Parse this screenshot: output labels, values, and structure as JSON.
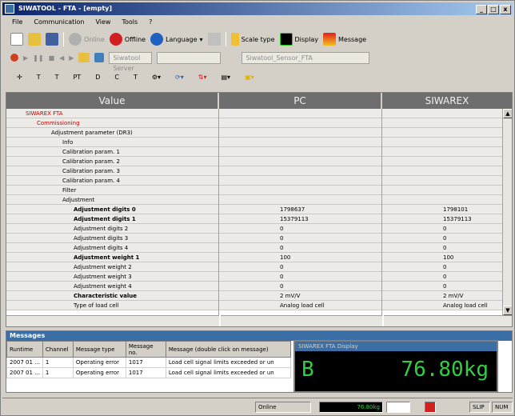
{
  "window": {
    "title": "SIWATOOL - FTA - [empty]"
  },
  "titlebar": {
    "buttons": [
      "_",
      "□",
      "x"
    ]
  },
  "menu": [
    "File",
    "Communication",
    "View",
    "Tools",
    "?"
  ],
  "toolbar1": [
    {
      "label": "Online",
      "disabled": true
    },
    {
      "label": "Offline",
      "disabled": false
    },
    {
      "label": "Language",
      "disabled": false
    },
    {
      "label": "Scale type",
      "disabled": false
    },
    {
      "label": "Display",
      "disabled": false
    },
    {
      "label": "Message",
      "disabled": false
    }
  ],
  "toolbar2": {
    "port": "Siwatool Server",
    "connection": "Siwatool_Sensor_FTA"
  },
  "toolbar3": [
    "T",
    "T",
    "PT",
    "D",
    "C",
    "T"
  ],
  "grid": {
    "headers": {
      "value": "Value",
      "pc": "PC",
      "siwarex": "SIWAREX"
    },
    "rows": [
      {
        "label": "SIWAREX FTA",
        "pc": "",
        "siwarex": "",
        "level": 0,
        "bold": false
      },
      {
        "label": "Commissioning",
        "pc": "",
        "siwarex": "",
        "level": 1,
        "bold": false
      },
      {
        "label": "Adjustment parameter (DR3)",
        "pc": "",
        "siwarex": "",
        "level": 2,
        "bold": false
      },
      {
        "label": "Info",
        "pc": "",
        "siwarex": "",
        "level": 3,
        "bold": false
      },
      {
        "label": "Calibration param. 1",
        "pc": "",
        "siwarex": "",
        "level": 3,
        "bold": false
      },
      {
        "label": "Calibration param. 2",
        "pc": "",
        "siwarex": "",
        "level": 3,
        "bold": false
      },
      {
        "label": "Calibration param. 3",
        "pc": "",
        "siwarex": "",
        "level": 3,
        "bold": false
      },
      {
        "label": "Calibration param. 4",
        "pc": "",
        "siwarex": "",
        "level": 3,
        "bold": false
      },
      {
        "label": "Filter",
        "pc": "",
        "siwarex": "",
        "level": 3,
        "bold": false
      },
      {
        "label": "Adjustment",
        "pc": "",
        "siwarex": "",
        "level": 3,
        "bold": false
      },
      {
        "label": "Adjustment digits 0",
        "pc": "1798637",
        "siwarex": "1798101",
        "level": 4,
        "bold": true
      },
      {
        "label": "Adjustment digits 1",
        "pc": "15379113",
        "siwarex": "15379113",
        "level": 4,
        "bold": true
      },
      {
        "label": "Adjustment digits 2",
        "pc": "0",
        "siwarex": "0",
        "level": 4,
        "bold": false
      },
      {
        "label": "Adjustment digits 3",
        "pc": "0",
        "siwarex": "0",
        "level": 4,
        "bold": false
      },
      {
        "label": "Adjustment digits 4",
        "pc": "0",
        "siwarex": "0",
        "level": 4,
        "bold": false
      },
      {
        "label": "Adjustment weight 1",
        "pc": "100",
        "siwarex": "100",
        "level": 4,
        "bold": true
      },
      {
        "label": "Adjustment weight 2",
        "pc": "0",
        "siwarex": "0",
        "level": 4,
        "bold": false
      },
      {
        "label": "Adjustment weight 3",
        "pc": "0",
        "siwarex": "0",
        "level": 4,
        "bold": false
      },
      {
        "label": "Adjustment weight 4",
        "pc": "0",
        "siwarex": "0",
        "level": 4,
        "bold": false
      },
      {
        "label": "Characteristic value",
        "pc": "2 mV/V",
        "siwarex": "2 mV/V",
        "level": 4,
        "bold": true
      },
      {
        "label": "Type of load cell",
        "pc": "Analog load cell",
        "siwarex": "Analog load cell",
        "level": 4,
        "bold": false
      }
    ]
  },
  "messages": {
    "title": "Messages",
    "columns": [
      "Runtime",
      "Channel",
      "Message type",
      "Message no.",
      "Message (double click on message)"
    ],
    "rows": [
      [
        "2007 01 ...",
        "1",
        "Operating error",
        "1017",
        "Load cell signal limits exceeded or un"
      ],
      [
        "2007 01 ...",
        "1",
        "Operating error",
        "1017",
        "Load cell signal limits exceeded or un"
      ]
    ]
  },
  "weight_display": {
    "title": "SIWAREX FTA Display",
    "status": "B",
    "value": "76.80kg"
  },
  "statusbar": {
    "mode": "Online",
    "indicator": "76.80kg",
    "extra": "SLIP",
    "num": "NUM"
  }
}
